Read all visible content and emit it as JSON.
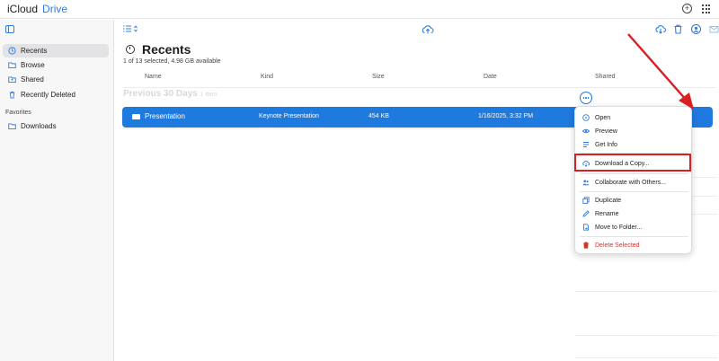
{
  "brand": {
    "prefix": "iCloud",
    "product": "Drive"
  },
  "sidebar": {
    "items": [
      {
        "label": "Recents",
        "icon": "clock-icon",
        "active": true
      },
      {
        "label": "Browse",
        "icon": "folder-icon"
      },
      {
        "label": "Shared",
        "icon": "shared-folder-icon"
      },
      {
        "label": "Recently Deleted",
        "icon": "trash-icon"
      }
    ],
    "favorites_heading": "Favorites",
    "favorites": [
      {
        "label": "Downloads",
        "icon": "folder-icon"
      }
    ]
  },
  "main": {
    "title": "Recents",
    "subtitle": "1 of 13 selected, 4.98 GB available",
    "columns": [
      "Name",
      "Kind",
      "Size",
      "Date",
      "Shared"
    ],
    "group_heading": "Previous 30 Days",
    "group_count": "1 item",
    "rows": [
      {
        "name": "Presentation",
        "kind": "Keynote Presentation",
        "size": "454 KB",
        "date": "1/16/2025, 3:32 PM",
        "selected": true
      }
    ]
  },
  "context_menu": {
    "items": [
      {
        "label": "Open",
        "icon": "info-circle-icon"
      },
      {
        "label": "Preview",
        "icon": "eye-icon"
      },
      {
        "label": "Get Info",
        "icon": "list-icon"
      },
      {
        "label": "Download a Copy...",
        "icon": "cloud-download-icon",
        "highlighted": true
      },
      {
        "label": "Collaborate with Others...",
        "icon": "people-icon"
      },
      {
        "label": "Duplicate",
        "icon": "duplicate-icon"
      },
      {
        "label": "Rename",
        "icon": "pencil-icon"
      },
      {
        "label": "Move to Folder...",
        "icon": "move-folder-icon"
      },
      {
        "label": "Delete Selected",
        "icon": "trash-icon",
        "danger": true
      }
    ]
  },
  "colors": {
    "accent": "#1f7ae0",
    "annotation": "#d71f24",
    "danger": "#d83226"
  }
}
